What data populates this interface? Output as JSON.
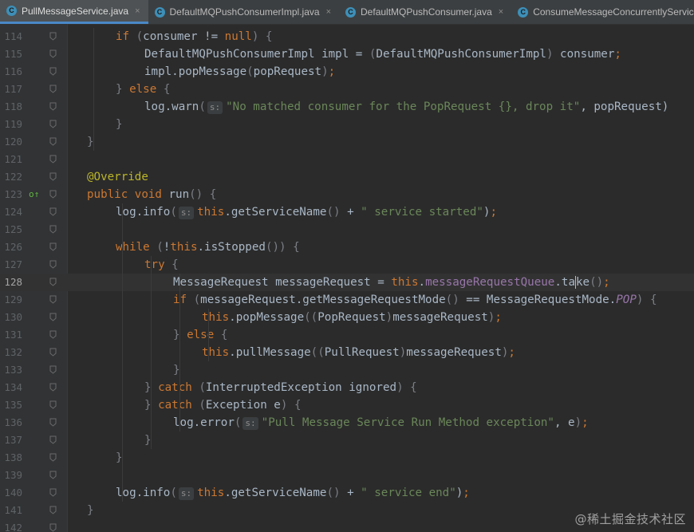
{
  "tabs": [
    {
      "icon": "class-icon",
      "icon_letter": "C",
      "label": "PullMessageService.java",
      "active": true
    },
    {
      "icon": "class-icon",
      "icon_letter": "C",
      "label": "DefaultMQPushConsumerImpl.java",
      "active": false
    },
    {
      "icon": "class-icon",
      "icon_letter": "C",
      "label": "DefaultMQPushConsumer.java",
      "active": false
    },
    {
      "icon": "class-icon",
      "icon_letter": "C",
      "label": "ConsumeMessageConcurrentlyService.java",
      "active": false
    }
  ],
  "close_glyph": "×",
  "hint_label": "s:",
  "current_line": "128",
  "watermark": "@稀土掘金技术社区",
  "lines": [
    {
      "n": "114",
      "indent": 1,
      "fold": "",
      "code": [
        [
          "kw",
          "if "
        ],
        [
          "brk",
          "("
        ],
        [
          "",
          "consumer != "
        ],
        [
          "kw",
          "null"
        ],
        [
          "brk",
          ") {"
        ]
      ]
    },
    {
      "n": "115",
      "indent": 2,
      "fold": "",
      "code": [
        [
          "",
          "DefaultMQPushConsumerImpl impl = "
        ],
        [
          "brk",
          "("
        ],
        [
          "",
          "DefaultMQPushConsumerImpl"
        ],
        [
          "brk",
          ")"
        ],
        [
          "",
          " consumer"
        ],
        [
          "kw",
          ";"
        ]
      ]
    },
    {
      "n": "116",
      "indent": 2,
      "fold": "",
      "code": [
        [
          "",
          "impl.popMessage"
        ],
        [
          "brk",
          "("
        ],
        [
          "",
          "popRequest"
        ],
        [
          "brk",
          ")"
        ],
        [
          "kw",
          ";"
        ]
      ]
    },
    {
      "n": "117",
      "indent": 1,
      "fold": "",
      "code": [
        [
          "brk",
          "} "
        ],
        [
          "kw",
          "else "
        ],
        [
          "brk",
          "{"
        ]
      ]
    },
    {
      "n": "118",
      "indent": 2,
      "fold": "",
      "code": [
        [
          "",
          "log.warn"
        ],
        [
          "brk",
          "("
        ],
        [
          "hint",
          "s:"
        ],
        [
          "str",
          "\"No matched consumer for the PopRequest {}, drop it\""
        ],
        [
          "",
          ", popRequest)"
        ]
      ]
    },
    {
      "n": "119",
      "indent": 1,
      "fold": "",
      "code": [
        [
          "brk",
          "}"
        ]
      ]
    },
    {
      "n": "120",
      "indent": 0,
      "fold": "",
      "code": [
        [
          "brk",
          "}"
        ]
      ]
    },
    {
      "n": "121",
      "indent": 0,
      "fold": "",
      "code": []
    },
    {
      "n": "122",
      "indent": 0,
      "fold": "",
      "code": [
        [
          "ann",
          "@Override"
        ]
      ]
    },
    {
      "n": "123",
      "indent": 0,
      "fold": "",
      "marker": "o↑",
      "code": [
        [
          "kw",
          "public void "
        ],
        [
          "",
          "run"
        ],
        [
          "brk",
          "() {"
        ]
      ]
    },
    {
      "n": "124",
      "indent": 1,
      "fold": "",
      "code": [
        [
          "",
          "log.info"
        ],
        [
          "brk",
          "("
        ],
        [
          "hint",
          "s:"
        ],
        [
          "kw",
          "this"
        ],
        [
          "",
          ".getServiceName"
        ],
        [
          "brk",
          "()"
        ],
        [
          "",
          " + "
        ],
        [
          "str",
          "\" service started\""
        ],
        [
          "",
          ")"
        ],
        [
          "kw",
          ";"
        ]
      ]
    },
    {
      "n": "125",
      "indent": 0,
      "fold": "",
      "code": []
    },
    {
      "n": "126",
      "indent": 1,
      "fold": "",
      "code": [
        [
          "kw",
          "while "
        ],
        [
          "brk",
          "("
        ],
        [
          "",
          "!"
        ],
        [
          "kw",
          "this"
        ],
        [
          "",
          ".isStopped"
        ],
        [
          "brk",
          "()) {"
        ]
      ]
    },
    {
      "n": "127",
      "indent": 2,
      "fold": "",
      "code": [
        [
          "kw",
          "try "
        ],
        [
          "brk",
          "{"
        ]
      ]
    },
    {
      "n": "128",
      "indent": 3,
      "fold": "",
      "code": [
        [
          "",
          "MessageRequest messageRequest = "
        ],
        [
          "kw",
          "this"
        ],
        [
          "",
          "."
        ],
        [
          "fld",
          "messageRequestQueue"
        ],
        [
          "",
          ".ta"
        ],
        [
          "caret",
          ""
        ],
        [
          "",
          "ke"
        ],
        [
          "brk",
          "()"
        ],
        [
          "kw",
          ";"
        ]
      ]
    },
    {
      "n": "129",
      "indent": 3,
      "fold": "",
      "code": [
        [
          "kw",
          "if "
        ],
        [
          "brk",
          "("
        ],
        [
          "",
          "messageRequest.getMessageRequestMode"
        ],
        [
          "brk",
          "()"
        ],
        [
          "",
          " == MessageRequestMode."
        ],
        [
          "fldi",
          "POP"
        ],
        [
          "brk",
          ") {"
        ]
      ]
    },
    {
      "n": "130",
      "indent": 4,
      "fold": "",
      "code": [
        [
          "kw",
          "this"
        ],
        [
          "",
          ".popMessage"
        ],
        [
          "brk",
          "(("
        ],
        [
          "",
          "PopRequest"
        ],
        [
          "brk",
          ")"
        ],
        [
          "",
          "messageRequest"
        ],
        [
          "brk",
          ")"
        ],
        [
          "kw",
          ";"
        ]
      ]
    },
    {
      "n": "131",
      "indent": 3,
      "fold": "",
      "code": [
        [
          "brk",
          "} "
        ],
        [
          "kw",
          "else "
        ],
        [
          "brk",
          "{"
        ]
      ]
    },
    {
      "n": "132",
      "indent": 4,
      "fold": "",
      "code": [
        [
          "kw",
          "this"
        ],
        [
          "",
          ".pullMessage"
        ],
        [
          "brk",
          "(("
        ],
        [
          "",
          "PullRequest"
        ],
        [
          "brk",
          ")"
        ],
        [
          "",
          "messageRequest"
        ],
        [
          "brk",
          ")"
        ],
        [
          "kw",
          ";"
        ]
      ]
    },
    {
      "n": "133",
      "indent": 3,
      "fold": "",
      "code": [
        [
          "brk",
          "}"
        ]
      ]
    },
    {
      "n": "134",
      "indent": 2,
      "fold": "",
      "code": [
        [
          "brk",
          "} "
        ],
        [
          "kw",
          "catch "
        ],
        [
          "brk",
          "("
        ],
        [
          "",
          "InterruptedException ignored"
        ],
        [
          "brk",
          ") {"
        ]
      ]
    },
    {
      "n": "135",
      "indent": 2,
      "fold": "",
      "code": [
        [
          "brk",
          "} "
        ],
        [
          "kw",
          "catch "
        ],
        [
          "brk",
          "("
        ],
        [
          "",
          "Exception e"
        ],
        [
          "brk",
          ") {"
        ]
      ]
    },
    {
      "n": "136",
      "indent": 3,
      "fold": "",
      "code": [
        [
          "",
          "log.error"
        ],
        [
          "brk",
          "("
        ],
        [
          "hint",
          "s:"
        ],
        [
          "str",
          "\"Pull Message Service Run Method exception\""
        ],
        [
          "",
          ", e"
        ],
        [
          "brk",
          ")"
        ],
        [
          "kw",
          ";"
        ]
      ]
    },
    {
      "n": "137",
      "indent": 2,
      "fold": "",
      "code": [
        [
          "brk",
          "}"
        ]
      ]
    },
    {
      "n": "138",
      "indent": 1,
      "fold": "",
      "code": [
        [
          "brk",
          "}"
        ]
      ]
    },
    {
      "n": "139",
      "indent": 0,
      "fold": "",
      "code": []
    },
    {
      "n": "140",
      "indent": 1,
      "fold": "",
      "code": [
        [
          "",
          "log.info"
        ],
        [
          "brk",
          "("
        ],
        [
          "hint",
          "s:"
        ],
        [
          "kw",
          "this"
        ],
        [
          "",
          ".getServiceName"
        ],
        [
          "brk",
          "()"
        ],
        [
          "",
          " + "
        ],
        [
          "str",
          "\" service end\""
        ],
        [
          "",
          ")"
        ],
        [
          "kw",
          ";"
        ]
      ]
    },
    {
      "n": "141",
      "indent": 0,
      "fold": "",
      "code": [
        [
          "brk",
          "}"
        ]
      ]
    },
    {
      "n": "142",
      "indent": 0,
      "fold": "",
      "code": []
    }
  ]
}
